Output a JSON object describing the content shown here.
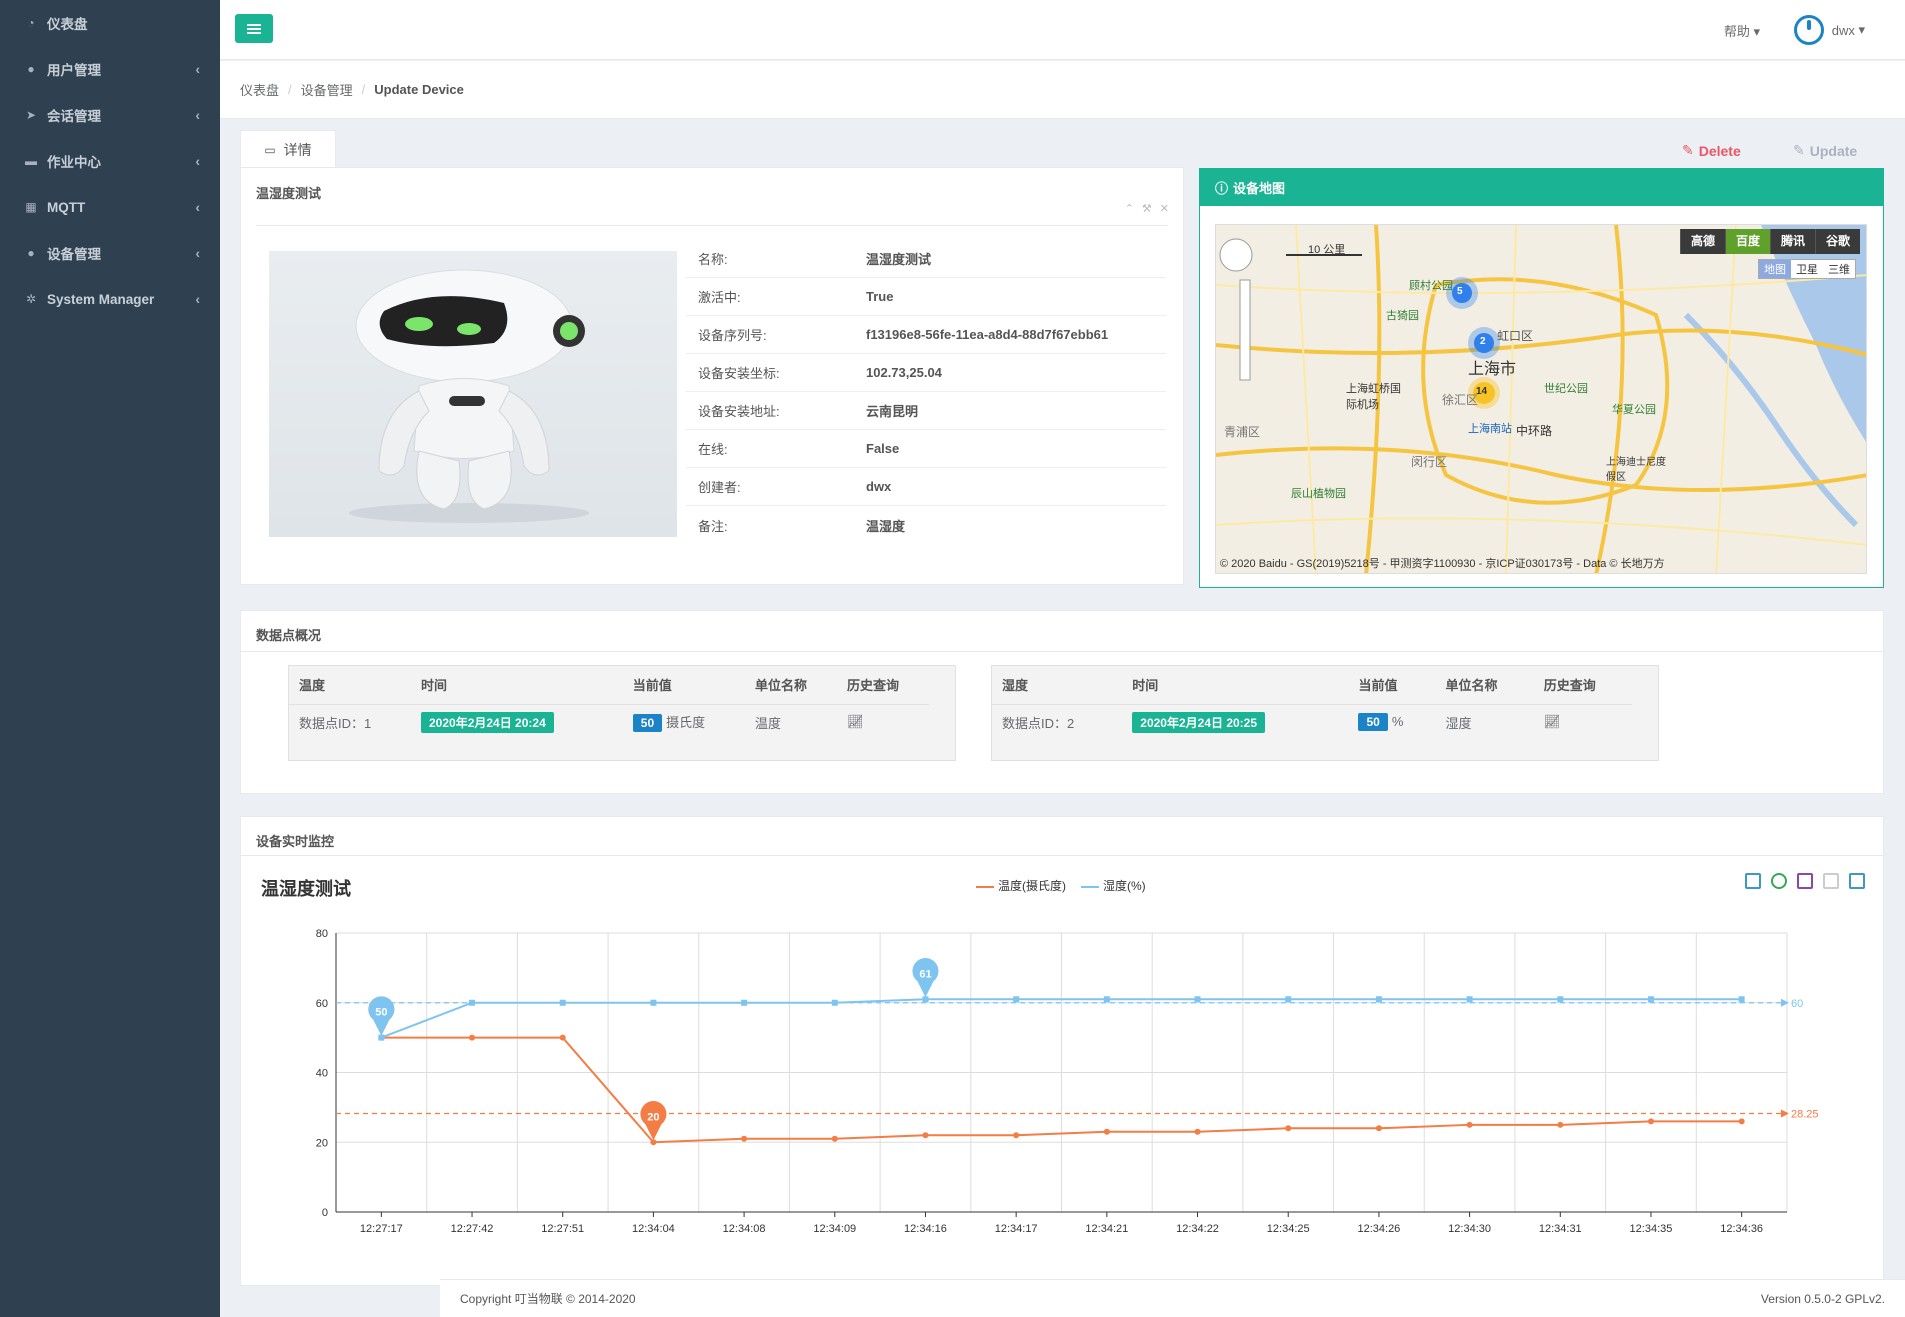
{
  "sidebar": {
    "items": [
      {
        "label": "仪表盘",
        "icon": "dashboard-icon"
      },
      {
        "label": "用户管理",
        "icon": "users-icon"
      },
      {
        "label": "会话管理",
        "icon": "rocket-icon"
      },
      {
        "label": "作业中心",
        "icon": "coffee-icon"
      },
      {
        "label": "MQTT",
        "icon": "grid-icon"
      },
      {
        "label": "设备管理",
        "icon": "apple-icon"
      },
      {
        "label": "System Manager",
        "icon": "gears-icon"
      }
    ]
  },
  "topbar": {
    "help": "帮助",
    "user": "dwx"
  },
  "breadcrumb": {
    "home": "仪表盘",
    "section": "设备管理",
    "current": "Update Device"
  },
  "tab": {
    "label": "详情"
  },
  "actions": {
    "delete": "Delete",
    "update": "Update"
  },
  "device": {
    "title": "温湿度测试",
    "fields": [
      {
        "k": "名称:",
        "v": "温湿度测试"
      },
      {
        "k": "激活中:",
        "v": "True"
      },
      {
        "k": "设备序列号:",
        "v": "f13196e8-56fe-11ea-a8d4-88d7f67ebb61"
      },
      {
        "k": "设备安装坐标:",
        "v": "102.73,25.04"
      },
      {
        "k": "设备安装地址:",
        "v": "云南昆明"
      },
      {
        "k": "在线:",
        "v": "False"
      },
      {
        "k": "创建者:",
        "v": "dwx"
      },
      {
        "k": "备注:",
        "v": "温湿度"
      }
    ]
  },
  "map": {
    "title": "设备地图",
    "providers": [
      "高德",
      "百度",
      "腾讯",
      "谷歌"
    ],
    "active_provider": "百度",
    "types": [
      "地图",
      "卫星",
      "三维"
    ],
    "scale": "10 公里",
    "city": "上海市",
    "clusters": [
      "5",
      "2",
      "14"
    ],
    "copyright": "© 2020 Baidu - GS(2019)5218号 - 甲测资字1100930 - 京ICP证030173号 - Data © 长地万方",
    "places": [
      "虹口区",
      "上海虹桥国际机场",
      "顾村公园",
      "古猗园",
      "世纪公园",
      "华夏公园",
      "上海南站",
      "中环路",
      "闵行区",
      "青浦区",
      "辰山植物园",
      "上海迪士尼度假区",
      "徐汇区"
    ]
  },
  "datapoints": {
    "title": "数据点概况",
    "headers": [
      "时间",
      "当前值",
      "单位名称",
      "历史查询"
    ],
    "items": [
      {
        "name": "温度",
        "id_label": "数据点ID：1",
        "time": "2020年2月24日 20:24",
        "value": "50",
        "unit": "摄氏度",
        "unit_name": "温度"
      },
      {
        "name": "湿度",
        "id_label": "数据点ID：2",
        "time": "2020年2月24日 20:25",
        "value": "50",
        "unit": "%",
        "unit_name": "湿度"
      }
    ]
  },
  "monitor": {
    "title": "设备实时监控"
  },
  "chart_data": {
    "type": "line",
    "title": "温湿度测试",
    "categories": [
      "12:27:17",
      "12:27:42",
      "12:27:51",
      "12:34:04",
      "12:34:08",
      "12:34:09",
      "12:34:16",
      "12:34:17",
      "12:34:21",
      "12:34:22",
      "12:34:25",
      "12:34:26",
      "12:34:30",
      "12:34:31",
      "12:34:35",
      "12:34:36"
    ],
    "ylim": [
      0,
      80
    ],
    "yticks": [
      0,
      20,
      40,
      60,
      80
    ],
    "series": [
      {
        "name": "温度(摄氏度)",
        "color": "#f47c45",
        "values": [
          50,
          50,
          50,
          20,
          21,
          21,
          22,
          22,
          23,
          23,
          24,
          24,
          25,
          25,
          26,
          26
        ],
        "mean": 28.25,
        "mean_label": "28.25",
        "pins": [
          {
            "index": 0,
            "label": "50"
          },
          {
            "index": 3,
            "label": "20"
          }
        ]
      },
      {
        "name": "湿度(%)",
        "color": "#7ec4f0",
        "values": [
          50,
          60,
          60,
          60,
          60,
          60,
          61,
          61,
          61,
          61,
          61,
          61,
          61,
          61,
          61,
          61
        ],
        "mean": 60,
        "mean_label": "60",
        "pins": [
          {
            "index": 0,
            "label": "50"
          },
          {
            "index": 6,
            "label": "61"
          }
        ]
      }
    ]
  },
  "footer": {
    "copyright": "Copyright 叮当物联 © 2014-2020",
    "version": "Version 0.5.0-2 GPLv2."
  }
}
